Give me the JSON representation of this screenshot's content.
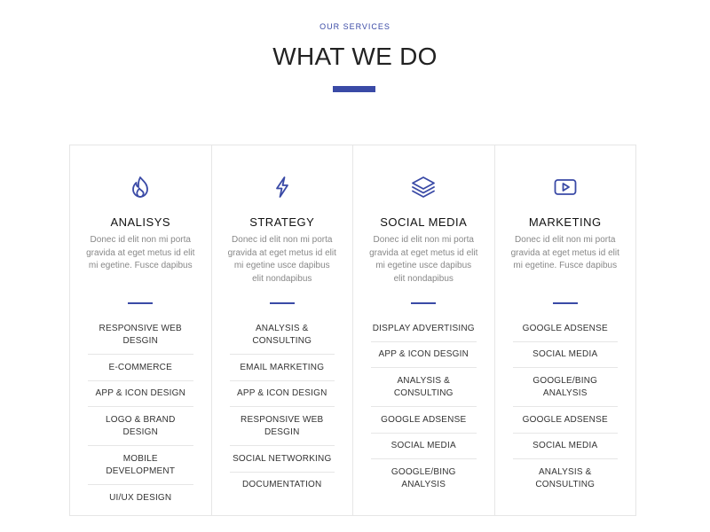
{
  "header": {
    "eyebrow": "OUR SERVICES",
    "title": "WHAT WE DO",
    "accent_color": "#3a4aa6"
  },
  "columns": [
    {
      "icon": "flame-icon",
      "title": "ANALISYS",
      "description": "Donec id elit non mi porta gravida at eget metus id elit mi egetine. Fusce dapibus",
      "items": [
        "RESPONSIVE WEB DESGIN",
        "E-COMMERCE",
        "APP & ICON DESIGN",
        "LOGO & BRAND DESIGN",
        "MOBILE DEVELOPMENT",
        "UI/UX DESIGN"
      ]
    },
    {
      "icon": "lightning-icon",
      "title": "STRATEGY",
      "description": "Donec id elit non mi porta gravida at eget metus id elit mi egetine usce dapibus elit nondapibus",
      "items": [
        "ANALYSIS & CONSULTING",
        "EMAIL MARKETING",
        "APP & ICON DESIGN",
        "RESPONSIVE WEB DESGIN",
        "SOCIAL NETWORKING",
        "DOCUMENTATION"
      ]
    },
    {
      "icon": "layers-icon",
      "title": "SOCIAL MEDIA",
      "description": "Donec id elit non mi porta gravida at eget metus id elit mi egetine usce dapibus elit nondapibus",
      "items": [
        "DISPLAY ADVERTISING",
        "APP & ICON DESGIN",
        "ANALYSIS & CONSULTING",
        "GOOGLE ADSENSE",
        "SOCIAL MEDIA",
        "GOOGLE/BING ANALYSIS"
      ]
    },
    {
      "icon": "play-icon",
      "title": "MARKETING",
      "description": "Donec id elit non mi porta gravida at eget metus id elit mi egetine. Fusce dapibus",
      "items": [
        "GOOGLE ADSENSE",
        "SOCIAL MEDIA",
        "GOOGLE/BING ANALYSIS",
        "GOOGLE ADSENSE",
        "SOCIAL MEDIA",
        "ANALYSIS & CONSULTING"
      ]
    }
  ]
}
